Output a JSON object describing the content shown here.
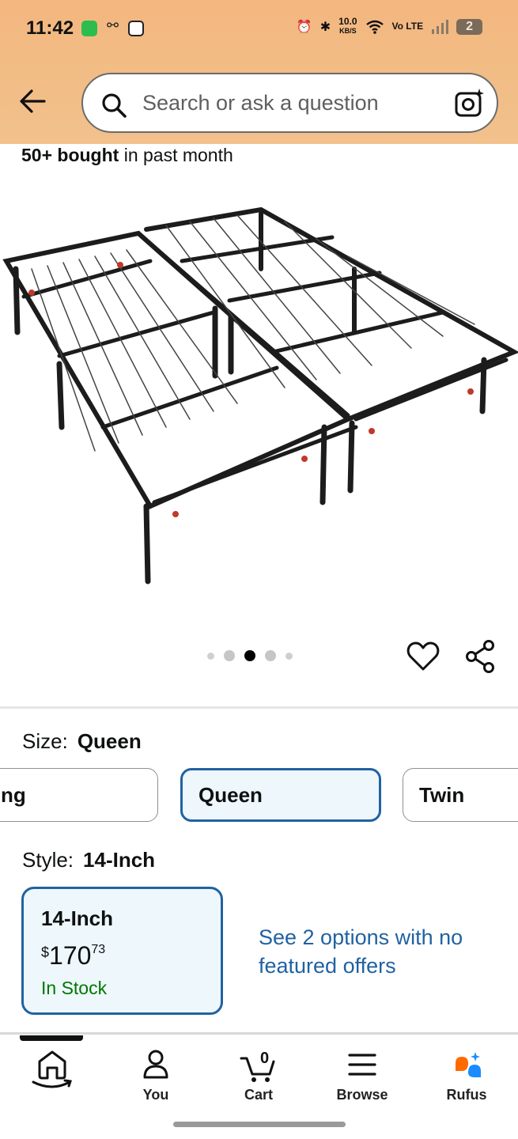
{
  "status_bar": {
    "time": "11:42",
    "net_speed_value": "10.0",
    "net_speed_unit": "KB/S",
    "lte": "Vo LTE",
    "battery": "2"
  },
  "search": {
    "placeholder": "Search or ask a question"
  },
  "product": {
    "bought_bold": "50+ bought",
    "bought_rest": " in past month",
    "image_alt": "Metal platform bed frame"
  },
  "carousel": {
    "count": 5,
    "active_index": 2
  },
  "size": {
    "label": "Size:",
    "value": "Queen",
    "options": [
      "ng",
      "Queen",
      "Twin"
    ]
  },
  "style": {
    "label": "Style:",
    "value": "14-Inch",
    "card": {
      "title": "14-Inch",
      "currency": "$",
      "price_whole": "170",
      "price_cents": "73",
      "stock": "In Stock"
    },
    "see_options": "See 2 options with no featured offers"
  },
  "tabbar": {
    "items": [
      {
        "label": "",
        "icon": "home-icon"
      },
      {
        "label": "You",
        "icon": "person-icon"
      },
      {
        "label": "Cart",
        "icon": "cart-icon",
        "badge": "0"
      },
      {
        "label": "Browse",
        "icon": "menu-icon"
      },
      {
        "label": "Rufus",
        "icon": "rufus-icon"
      }
    ]
  },
  "colors": {
    "header": "#f3b77f",
    "selected_border": "#2162a1",
    "selected_bg": "#edf7fc",
    "in_stock": "#007600",
    "link": "#2162a1"
  }
}
